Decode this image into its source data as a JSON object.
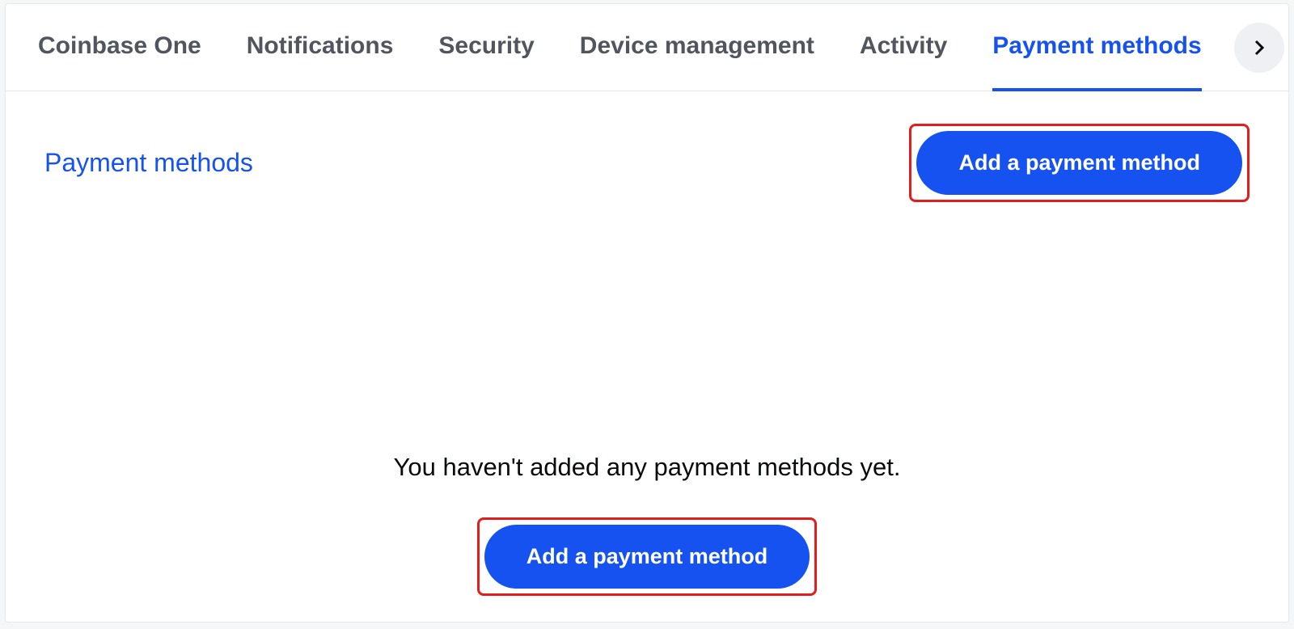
{
  "tabs": {
    "items": [
      {
        "label": "Coinbase One",
        "active": false
      },
      {
        "label": "Notifications",
        "active": false
      },
      {
        "label": "Security",
        "active": false
      },
      {
        "label": "Device management",
        "active": false
      },
      {
        "label": "Activity",
        "active": false
      },
      {
        "label": "Payment methods",
        "active": true
      }
    ]
  },
  "section": {
    "title": "Payment methods",
    "add_button_label": "Add a payment method"
  },
  "empty_state": {
    "message": "You haven't added any payment methods yet.",
    "cta_label": "Add a payment method"
  },
  "colors": {
    "brand": "#1652f0",
    "highlight": "#e11d1d"
  }
}
